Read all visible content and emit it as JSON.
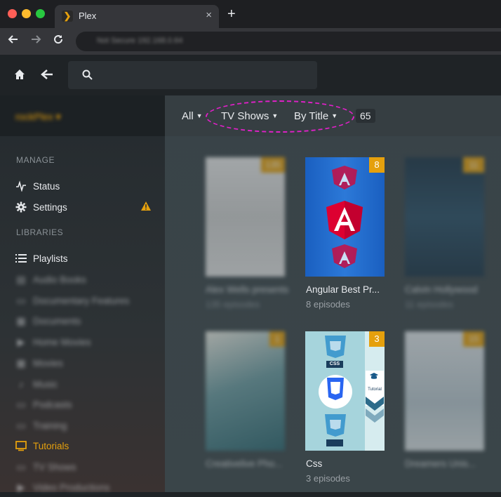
{
  "browser": {
    "tab_title": "Plex",
    "tab_close": "×",
    "new_tab": "+",
    "favicon_glyph": "❯",
    "address_text": "Not Secure  192.168.0.64"
  },
  "sidebar": {
    "server_name": "rockPlex ▾",
    "manage_header": "MANAGE",
    "libraries_header": "LIBRARIES",
    "manage_items": [
      {
        "label": "Status",
        "icon": "activity-icon"
      },
      {
        "label": "Settings",
        "icon": "gear-icon"
      }
    ],
    "playlists_label": "Playlists",
    "blurred_libraries": [
      "Audio Books",
      "Documentary Features",
      "Documents",
      "Home Movies",
      "Movies",
      "Music",
      "Podcasts",
      "Training"
    ],
    "active_library": "Tutorials",
    "below_libraries": [
      "TV Shows",
      "Video Productions"
    ]
  },
  "filters": {
    "all": "All",
    "type": "TV Shows",
    "sort": "By Title",
    "count": "65"
  },
  "cards": [
    {
      "title": "Alex Wells presents",
      "subtitle": "135 episodes",
      "badge": "135",
      "blurred": true
    },
    {
      "title": "Angular Best Pr...",
      "subtitle": "8 episodes",
      "badge": "8",
      "blurred": false
    },
    {
      "title": "Calvin Hollywood",
      "subtitle": "11 episodes",
      "badge": "11",
      "blurred": true
    },
    {
      "title": "Creativelive Pho...",
      "subtitle": "",
      "badge": "1",
      "blurred": true
    },
    {
      "title": "Css",
      "subtitle": "3 episodes",
      "badge": "3",
      "blurred": false
    },
    {
      "title": "Dreamers Unis...",
      "subtitle": "",
      "badge": "15",
      "blurred": true
    }
  ],
  "poster_text": {
    "css_small": "CSS",
    "tutorial": "Tutorial"
  },
  "colors": {
    "accent": "#e5a00d",
    "highlight_ellipse": "#e020c8",
    "angular_red": "#dd0031"
  }
}
